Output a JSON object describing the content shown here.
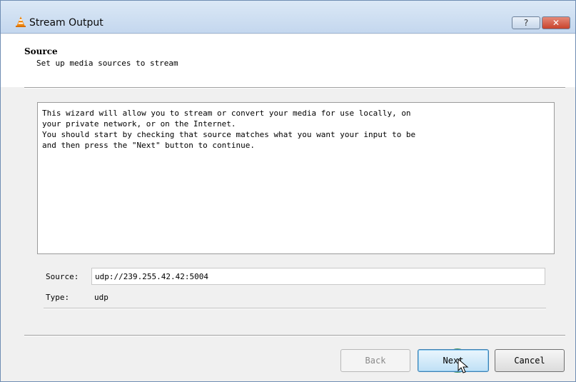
{
  "window": {
    "title": "Stream Output",
    "help_label": "?",
    "close_label": "✕",
    "accent_color": "#c4d7ee",
    "close_color": "#c8432c",
    "icon": "vlc-cone-icon"
  },
  "header": {
    "title": "Source",
    "subtitle": "Set up media sources to stream"
  },
  "info": {
    "text": "This wizard will allow you to stream or convert your media for use locally, on\nyour private network, or on the Internet.\nYou should start by checking that source matches what you want your input to be\nand then press the \"Next\" button to continue."
  },
  "source": {
    "label": "Source:",
    "value": "udp://239.255.42.42:5004"
  },
  "type": {
    "label": "Type:",
    "value": "udp"
  },
  "buttons": {
    "back": "Back",
    "next": "Next",
    "cancel": "Cancel"
  }
}
